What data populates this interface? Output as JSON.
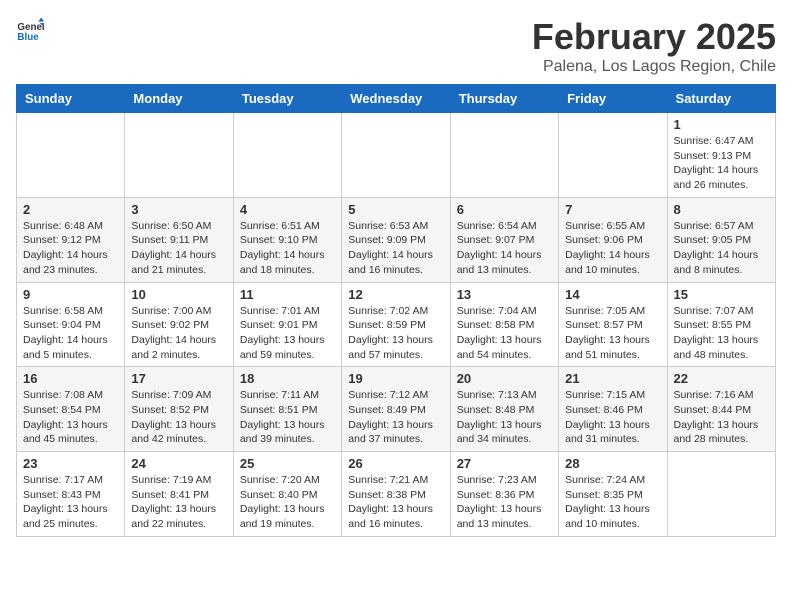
{
  "header": {
    "logo_general": "General",
    "logo_blue": "Blue",
    "month": "February 2025",
    "location": "Palena, Los Lagos Region, Chile"
  },
  "weekdays": [
    "Sunday",
    "Monday",
    "Tuesday",
    "Wednesday",
    "Thursday",
    "Friday",
    "Saturday"
  ],
  "weeks": [
    [
      {
        "day": "",
        "info": ""
      },
      {
        "day": "",
        "info": ""
      },
      {
        "day": "",
        "info": ""
      },
      {
        "day": "",
        "info": ""
      },
      {
        "day": "",
        "info": ""
      },
      {
        "day": "",
        "info": ""
      },
      {
        "day": "1",
        "info": "Sunrise: 6:47 AM\nSunset: 9:13 PM\nDaylight: 14 hours\nand 26 minutes."
      }
    ],
    [
      {
        "day": "2",
        "info": "Sunrise: 6:48 AM\nSunset: 9:12 PM\nDaylight: 14 hours\nand 23 minutes."
      },
      {
        "day": "3",
        "info": "Sunrise: 6:50 AM\nSunset: 9:11 PM\nDaylight: 14 hours\nand 21 minutes."
      },
      {
        "day": "4",
        "info": "Sunrise: 6:51 AM\nSunset: 9:10 PM\nDaylight: 14 hours\nand 18 minutes."
      },
      {
        "day": "5",
        "info": "Sunrise: 6:53 AM\nSunset: 9:09 PM\nDaylight: 14 hours\nand 16 minutes."
      },
      {
        "day": "6",
        "info": "Sunrise: 6:54 AM\nSunset: 9:07 PM\nDaylight: 14 hours\nand 13 minutes."
      },
      {
        "day": "7",
        "info": "Sunrise: 6:55 AM\nSunset: 9:06 PM\nDaylight: 14 hours\nand 10 minutes."
      },
      {
        "day": "8",
        "info": "Sunrise: 6:57 AM\nSunset: 9:05 PM\nDaylight: 14 hours\nand 8 minutes."
      }
    ],
    [
      {
        "day": "9",
        "info": "Sunrise: 6:58 AM\nSunset: 9:04 PM\nDaylight: 14 hours\nand 5 minutes."
      },
      {
        "day": "10",
        "info": "Sunrise: 7:00 AM\nSunset: 9:02 PM\nDaylight: 14 hours\nand 2 minutes."
      },
      {
        "day": "11",
        "info": "Sunrise: 7:01 AM\nSunset: 9:01 PM\nDaylight: 13 hours\nand 59 minutes."
      },
      {
        "day": "12",
        "info": "Sunrise: 7:02 AM\nSunset: 8:59 PM\nDaylight: 13 hours\nand 57 minutes."
      },
      {
        "day": "13",
        "info": "Sunrise: 7:04 AM\nSunset: 8:58 PM\nDaylight: 13 hours\nand 54 minutes."
      },
      {
        "day": "14",
        "info": "Sunrise: 7:05 AM\nSunset: 8:57 PM\nDaylight: 13 hours\nand 51 minutes."
      },
      {
        "day": "15",
        "info": "Sunrise: 7:07 AM\nSunset: 8:55 PM\nDaylight: 13 hours\nand 48 minutes."
      }
    ],
    [
      {
        "day": "16",
        "info": "Sunrise: 7:08 AM\nSunset: 8:54 PM\nDaylight: 13 hours\nand 45 minutes."
      },
      {
        "day": "17",
        "info": "Sunrise: 7:09 AM\nSunset: 8:52 PM\nDaylight: 13 hours\nand 42 minutes."
      },
      {
        "day": "18",
        "info": "Sunrise: 7:11 AM\nSunset: 8:51 PM\nDaylight: 13 hours\nand 39 minutes."
      },
      {
        "day": "19",
        "info": "Sunrise: 7:12 AM\nSunset: 8:49 PM\nDaylight: 13 hours\nand 37 minutes."
      },
      {
        "day": "20",
        "info": "Sunrise: 7:13 AM\nSunset: 8:48 PM\nDaylight: 13 hours\nand 34 minutes."
      },
      {
        "day": "21",
        "info": "Sunrise: 7:15 AM\nSunset: 8:46 PM\nDaylight: 13 hours\nand 31 minutes."
      },
      {
        "day": "22",
        "info": "Sunrise: 7:16 AM\nSunset: 8:44 PM\nDaylight: 13 hours\nand 28 minutes."
      }
    ],
    [
      {
        "day": "23",
        "info": "Sunrise: 7:17 AM\nSunset: 8:43 PM\nDaylight: 13 hours\nand 25 minutes."
      },
      {
        "day": "24",
        "info": "Sunrise: 7:19 AM\nSunset: 8:41 PM\nDaylight: 13 hours\nand 22 minutes."
      },
      {
        "day": "25",
        "info": "Sunrise: 7:20 AM\nSunset: 8:40 PM\nDaylight: 13 hours\nand 19 minutes."
      },
      {
        "day": "26",
        "info": "Sunrise: 7:21 AM\nSunset: 8:38 PM\nDaylight: 13 hours\nand 16 minutes."
      },
      {
        "day": "27",
        "info": "Sunrise: 7:23 AM\nSunset: 8:36 PM\nDaylight: 13 hours\nand 13 minutes."
      },
      {
        "day": "28",
        "info": "Sunrise: 7:24 AM\nSunset: 8:35 PM\nDaylight: 13 hours\nand 10 minutes."
      },
      {
        "day": "",
        "info": ""
      }
    ]
  ]
}
